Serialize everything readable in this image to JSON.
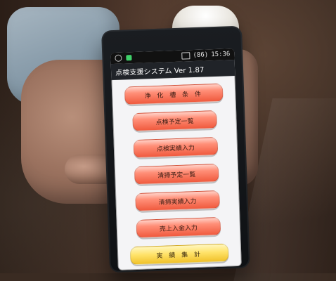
{
  "app": {
    "status_time": "15:36",
    "status_battery": "(86)",
    "title": "点検支援システム Ver 1.87"
  },
  "menu": {
    "items": [
      {
        "label": "浄 化 槽 条 件",
        "variant": "red"
      },
      {
        "label": "点検予定一覧",
        "variant": "red"
      },
      {
        "label": "点検実績入力",
        "variant": "red"
      },
      {
        "label": "清掃予定一覧",
        "variant": "red"
      },
      {
        "label": "清掃実績入力",
        "variant": "red"
      },
      {
        "label": "売上入金入力",
        "variant": "red"
      },
      {
        "label": "実 績 集 計",
        "variant": "yellow"
      }
    ]
  },
  "colors": {
    "button_red": "#f05a3e",
    "button_yellow": "#ffe36a",
    "screen_bg": "#f4f4f6"
  }
}
